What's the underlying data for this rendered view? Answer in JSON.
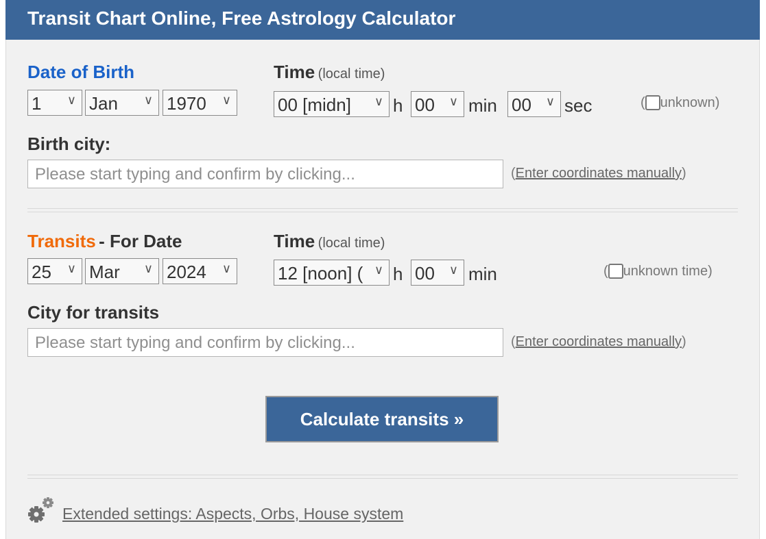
{
  "header": {
    "title": "Transit Chart Online, Free Astrology Calculator"
  },
  "birth": {
    "date_label": "Date of Birth",
    "time_label": "Time",
    "time_hint": "(local time)",
    "day": "1",
    "month": "Jan",
    "year": "1970",
    "hour": "00 [midn]",
    "hour_unit": "h",
    "minute": "00",
    "minute_unit": "min",
    "second": "00",
    "second_unit": "sec",
    "unknown_label": "unknown",
    "unknown_checked": false,
    "city_label": "Birth city:",
    "city_placeholder": "Please start typing and confirm by clicking...",
    "coords_link": "Enter coordinates manually"
  },
  "transits": {
    "label": "Transits",
    "separator": "- For Date",
    "time_label": "Time",
    "time_hint": "(local time)",
    "day": "25",
    "month": "Mar",
    "year": "2024",
    "hour": "12 [noon] (",
    "hour_unit": "h",
    "minute": "00",
    "minute_unit": "min",
    "unknown_label": "unknown time",
    "unknown_checked": false,
    "city_label": "City for transits",
    "city_placeholder": "Please start typing and confirm by clicking...",
    "coords_link": "Enter coordinates manually"
  },
  "actions": {
    "calculate_label": "Calculate transits »"
  },
  "footer": {
    "extended_link": "Extended settings: Aspects, Orbs, House system",
    "icon": "gears-icon"
  },
  "colors": {
    "header_bg": "#3b6699",
    "accent_blue": "#1a62c9",
    "accent_orange": "#f06a0a",
    "panel_bg": "#f1f1f1"
  }
}
